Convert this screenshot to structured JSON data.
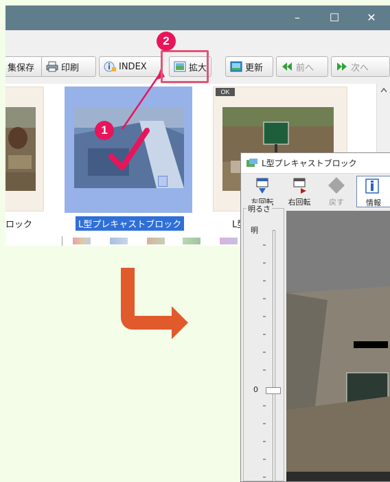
{
  "window": {
    "controls": {
      "minimize": "–",
      "maximize": "☐",
      "close": "✕"
    }
  },
  "toolbar": {
    "buttons": [
      {
        "label": "集保存"
      },
      {
        "label": "印刷"
      },
      {
        "label": "INDEX"
      },
      {
        "label": "拡大"
      },
      {
        "label": "更新"
      },
      {
        "label": "前へ"
      },
      {
        "label": "次へ"
      }
    ]
  },
  "thumbnails": [
    {
      "caption": "ロック"
    },
    {
      "caption": "L型プレキャストブロック",
      "selected": true
    },
    {
      "caption": "L型",
      "tag": "OK"
    }
  ],
  "annotations": {
    "step1": "1",
    "step2": "2",
    "accent": "#e8155b",
    "arrow": "#e05a2b"
  },
  "viewer": {
    "title": "L型プレキャストブロック",
    "buttons": [
      {
        "label": "左回転",
        "icon": "rotate-left-icon"
      },
      {
        "label": "右回転",
        "icon": "rotate-right-icon"
      },
      {
        "label": "戻す",
        "icon": "undo-icon"
      },
      {
        "label": "情報",
        "icon": "info-icon"
      }
    ],
    "brightness": {
      "group_label": "明るさ",
      "top_label": "明",
      "zero_label": "0"
    }
  },
  "colors": {
    "titlebar": "#607d8b",
    "selection": "#3f72d6",
    "page_bg": "#f3fde8"
  }
}
